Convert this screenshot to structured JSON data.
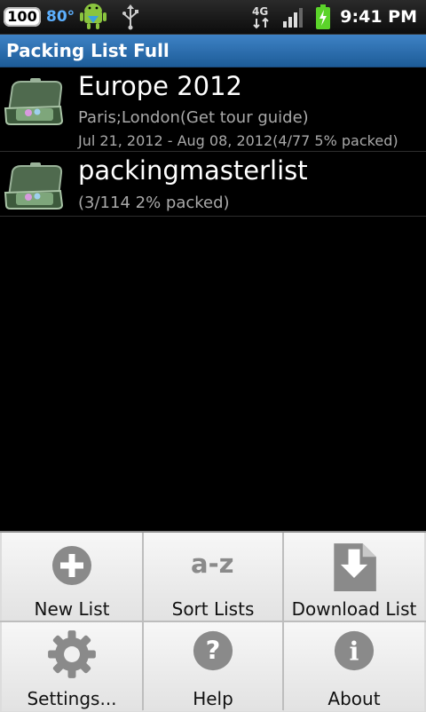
{
  "status_bar": {
    "battery_tag": "100",
    "temperature": "80°",
    "network_type": "4G",
    "time": "9:41 PM",
    "icons": [
      "android-notification-icon",
      "usb-icon",
      "4g-data-icon",
      "signal-icon",
      "battery-charging-icon"
    ]
  },
  "app": {
    "title": "Packing List Full"
  },
  "lists": [
    {
      "title": "Europe 2012",
      "subtitle": "Paris;London(Get tour guide)",
      "details": "Jul 21, 2012 - Aug 08, 2012(4/77 5% packed)",
      "icon": "suitcase-icon"
    },
    {
      "title": "packingmasterlist",
      "subtitle": "(3/114 2% packed)",
      "icon": "suitcase-icon"
    }
  ],
  "menu": {
    "items": [
      {
        "label": "New List",
        "icon": "plus-icon"
      },
      {
        "label": "Sort Lists",
        "icon": "a-z-icon",
        "glyph": "a-z"
      },
      {
        "label": "Download List",
        "icon": "download-icon"
      },
      {
        "label": "Settings...",
        "icon": "gear-icon"
      },
      {
        "label": "Help",
        "icon": "help-icon",
        "glyph": "?"
      },
      {
        "label": "About",
        "icon": "info-icon",
        "glyph": "i"
      }
    ]
  },
  "colors": {
    "title_bar": "#2d6fb0",
    "status_temp": "#5db0ff",
    "battery_green": "#5bd42a",
    "menu_bg": "#ededed",
    "icon_gray": "#8a8a8a"
  }
}
